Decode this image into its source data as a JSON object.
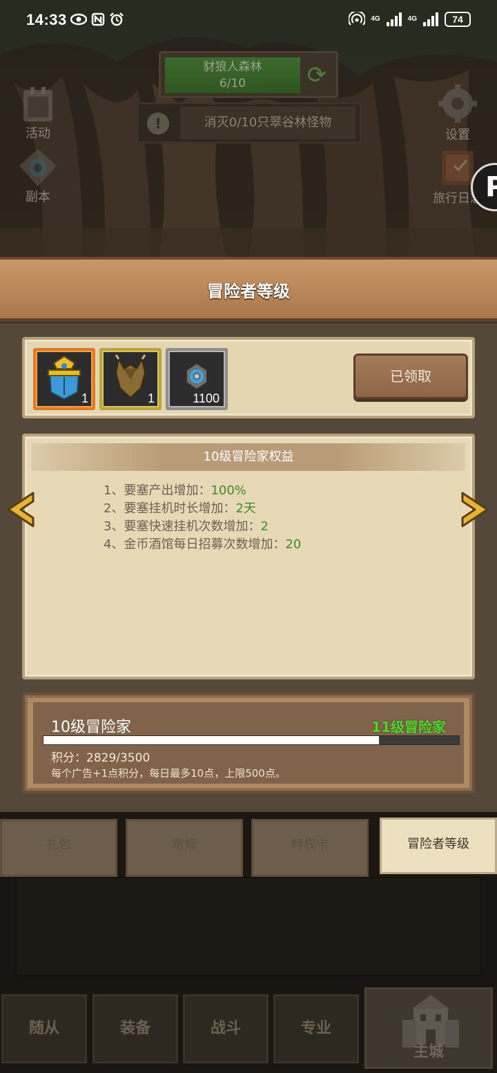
{
  "status_bar": {
    "time": "14:33",
    "net1": "4G",
    "net2": "4G",
    "battery": "74"
  },
  "hud": {
    "stage_name": "豺狼人森林",
    "stage_progress": "6/10",
    "quest_badge": "!",
    "quest_text": "消灭0/10只翠谷林怪物",
    "left_icons": [
      {
        "label": "活动",
        "icon": "calendar-icon"
      },
      {
        "label": "副本",
        "icon": "portal-icon"
      }
    ],
    "right_icons": [
      {
        "label": "设置",
        "icon": "gear-icon"
      },
      {
        "label": "旅行日志",
        "icon": "journal-icon"
      }
    ],
    "fab_glyph": "P"
  },
  "modal": {
    "title": "冒险者等级",
    "rewards": [
      {
        "icon": "helmet-armor-icon",
        "count": "1",
        "rarity": "orange"
      },
      {
        "icon": "chest-armor-icon",
        "count": "1",
        "rarity": "yellow"
      },
      {
        "icon": "gem-stone-icon",
        "count": "1100",
        "rarity": "gray"
      }
    ],
    "claim_button": "已领取",
    "benefits_title": "10级冒险家权益",
    "benefits": [
      {
        "text": "1、要塞产出增加：",
        "value": "100%"
      },
      {
        "text": "2、要塞挂机时长增加：",
        "value": "2天"
      },
      {
        "text": "3、要塞快速挂机次数增加：",
        "value": "2"
      },
      {
        "text": "4、金币酒馆每日招募次数增加：",
        "value": "20"
      }
    ],
    "progress": {
      "current_level": "10级冒险家",
      "next_level": "11级冒险家",
      "points": "积分：2829/3500",
      "fraction": 0.808,
      "note": "每个广告+1点积分，每日最多10点，上限500点。"
    }
  },
  "tabs": [
    "礼包",
    "常规",
    "特权卡",
    "冒险者等级"
  ],
  "bottom_nav": [
    "随从",
    "装备",
    "战斗",
    "专业",
    "主城"
  ],
  "colors": {
    "value_green": "#3f8a2a",
    "next_level_green": "#58d22e",
    "header_wood": "#b88658",
    "parchment": "#e7d8b6"
  }
}
